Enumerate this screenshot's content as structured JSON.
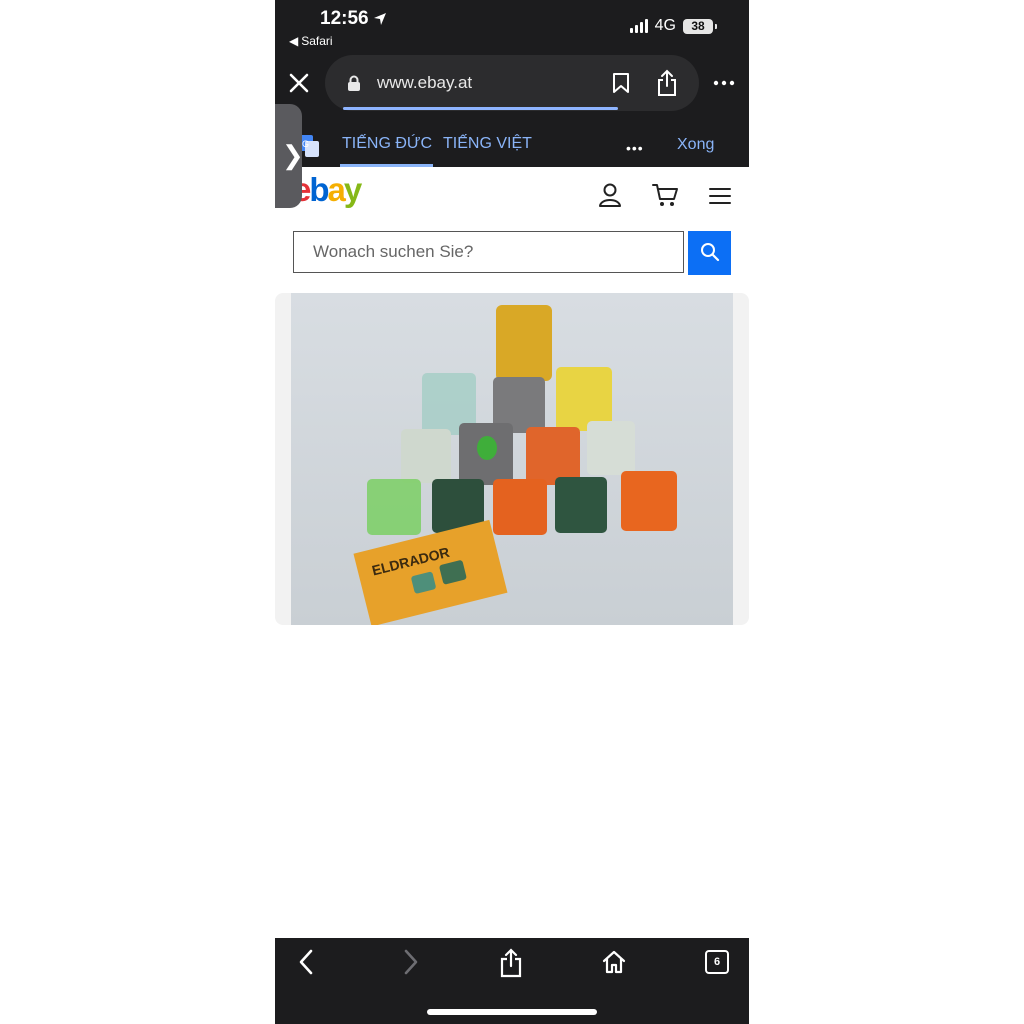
{
  "status_bar": {
    "time": "12:56",
    "back_app": "Safari",
    "network": "4G",
    "battery": "38"
  },
  "browser": {
    "url": "www.ebay.at",
    "tab_count": "6"
  },
  "translate_bar": {
    "source_language": "TIẾNG ĐỨC",
    "target_language": "TIẾNG VIỆT",
    "more": "•••",
    "done": "Xong"
  },
  "ebay": {
    "logo": {
      "e": "e",
      "b": "b",
      "a": "a",
      "y": "y"
    },
    "brand_colors": {
      "red": "#e53238",
      "blue": "#0064d2",
      "yellow": "#f5af02",
      "green": "#86b817"
    },
    "search_placeholder": "Wonach suchen Sie?",
    "search_button_color": "#0c6ff5"
  },
  "product_image": {
    "booklet_text": "ELDRADOR",
    "description": "toy figures"
  },
  "icons": [
    "location-arrow-icon",
    "signal-icon",
    "battery-icon",
    "close-icon",
    "lock-icon",
    "bookmark-icon",
    "share-icon",
    "more-icon",
    "translate-icon",
    "chevron-right-icon",
    "user-icon",
    "cart-icon",
    "menu-icon",
    "search-icon",
    "back-icon",
    "forward-icon",
    "home-icon",
    "tabs-icon"
  ]
}
